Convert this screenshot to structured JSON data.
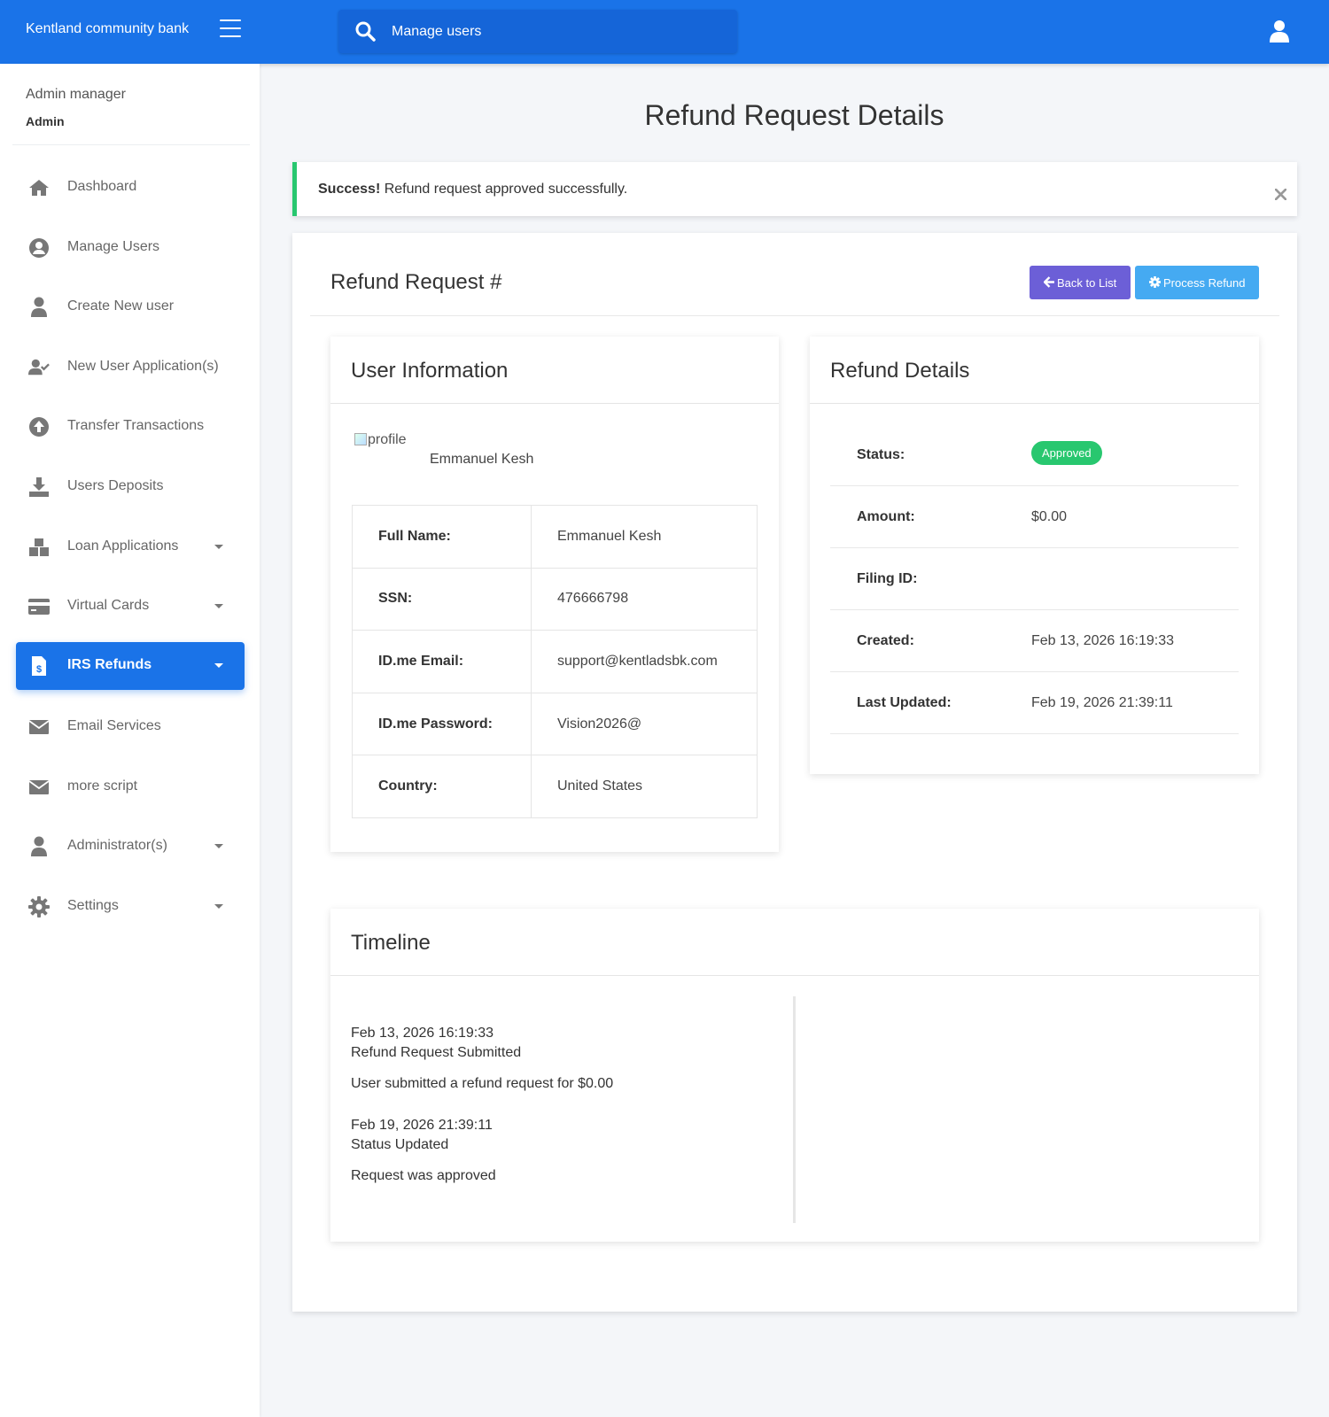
{
  "topbar": {
    "brand": "Kentland community bank",
    "search_placeholder": "Manage users",
    "colors": {
      "primary": "#1a73e8"
    }
  },
  "sidebar": {
    "profile": {
      "name": "Admin manager",
      "role": "Admin"
    },
    "items": [
      {
        "label": "Dashboard",
        "icon": "home-icon",
        "caret": false,
        "active": false
      },
      {
        "label": "Manage Users",
        "icon": "user-circle-icon",
        "caret": false,
        "active": false
      },
      {
        "label": "Create New user",
        "icon": "user-icon",
        "caret": false,
        "active": false
      },
      {
        "label": "New User Application(s)",
        "icon": "user-check-icon",
        "caret": false,
        "active": false
      },
      {
        "label": "Transfer Transactions",
        "icon": "arrow-up-circle-icon",
        "caret": false,
        "active": false
      },
      {
        "label": "Users Deposits",
        "icon": "download-icon",
        "caret": false,
        "active": false
      },
      {
        "label": "Loan Applications",
        "icon": "cubes-icon",
        "caret": true,
        "active": false
      },
      {
        "label": "Virtual Cards",
        "icon": "credit-card-icon",
        "caret": true,
        "active": false
      },
      {
        "label": "IRS Refunds",
        "icon": "invoice-dollar-icon",
        "caret": true,
        "active": true
      },
      {
        "label": "Email Services",
        "icon": "envelope-icon",
        "caret": false,
        "active": false
      },
      {
        "label": "more script",
        "icon": "envelope-icon",
        "caret": false,
        "active": false
      },
      {
        "label": "Administrator(s)",
        "icon": "user-icon",
        "caret": true,
        "active": false
      },
      {
        "label": "Settings",
        "icon": "gear-icon",
        "caret": true,
        "active": false
      }
    ]
  },
  "main": {
    "page_title": "Refund Request Details",
    "alert": {
      "strong": "Success!",
      "message": " Refund request approved successfully.",
      "accent": "#28c76f"
    },
    "card_title": "Refund Request #",
    "buttons": {
      "back": "Back to List",
      "process": "Process Refund"
    },
    "user_info": {
      "title": "User Information",
      "profile_alt": "profile",
      "profile_name": "Emmanuel Kesh",
      "rows": [
        {
          "label": "Full Name:",
          "value": "Emmanuel Kesh"
        },
        {
          "label": "SSN:",
          "value": "476666798"
        },
        {
          "label": "ID.me Email:",
          "value": "support@kentladsbk.com"
        },
        {
          "label": "ID.me Password:",
          "value": "Vision2026@"
        },
        {
          "label": "Country:",
          "value": "United States"
        }
      ]
    },
    "refund_details": {
      "title": "Refund Details",
      "status_label": "Status:",
      "status_value": "Approved",
      "rows": [
        {
          "label": "Amount:",
          "value": "$0.00"
        },
        {
          "label": "Filing ID:",
          "value": ""
        },
        {
          "label": "Created:",
          "value": "Feb 13, 2026 16:19:33"
        },
        {
          "label": "Last Updated:",
          "value": "Feb 19, 2026 21:39:11"
        }
      ]
    },
    "timeline": {
      "title": "Timeline",
      "events": [
        {
          "date": "Feb 13, 2026 16:19:33",
          "title": "Refund Request Submitted",
          "description": "User submitted a refund request for $0.00"
        },
        {
          "date": "Feb 19, 2026 21:39:11",
          "title": "Status Updated",
          "description": "Request was approved"
        }
      ]
    }
  }
}
